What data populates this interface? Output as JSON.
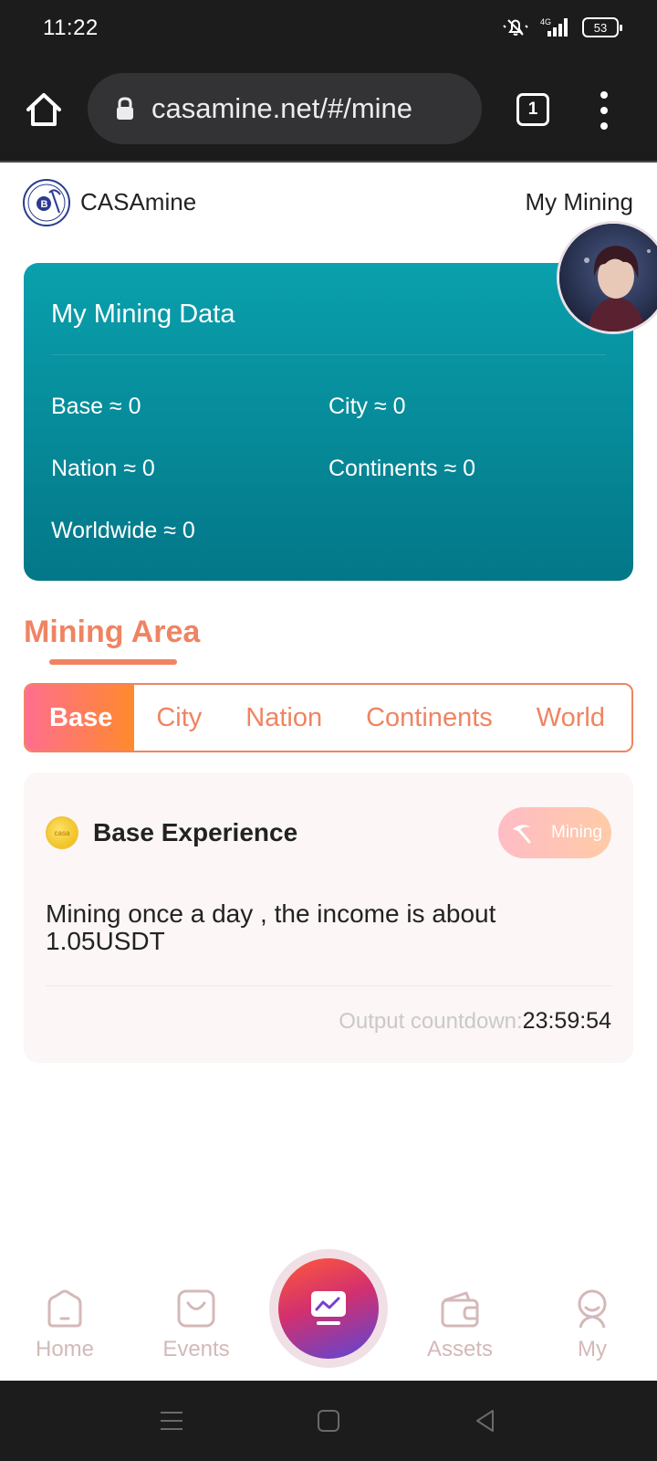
{
  "status_bar": {
    "time": "11:22",
    "network": "4G",
    "battery": "53"
  },
  "browser": {
    "url": "casamine.net/#/mine",
    "tab_count": "1"
  },
  "header": {
    "brand": "CASAmine",
    "my_mining_link": "My Mining"
  },
  "mining_data": {
    "title": "My Mining Data",
    "stats": [
      {
        "label": "Base ≈ 0"
      },
      {
        "label": "City ≈ 0"
      },
      {
        "label": "Nation ≈ 0"
      },
      {
        "label": "Continents ≈ 0"
      },
      {
        "label": "Worldwide ≈ 0"
      }
    ]
  },
  "mining_area": {
    "title": "Mining Area",
    "tabs": [
      {
        "label": "Base",
        "active": true
      },
      {
        "label": "City"
      },
      {
        "label": "Nation"
      },
      {
        "label": "Continents"
      },
      {
        "label": "World"
      }
    ]
  },
  "experience_card": {
    "coin_text": "casa",
    "title": "Base Experience",
    "mining_button": "Mining",
    "description": "Mining once a day , the income is about 1.05USDT",
    "countdown_label": "Output countdown:",
    "countdown_value": "23:59:54"
  },
  "bottom_nav": {
    "items": [
      {
        "label": "Home",
        "icon": "home-icon"
      },
      {
        "label": "Events",
        "icon": "shopping-bag-icon"
      },
      {
        "label": "",
        "icon": "chart-screen-icon"
      },
      {
        "label": "Assets",
        "icon": "wallet-icon"
      },
      {
        "label": "My",
        "icon": "profile-icon"
      }
    ]
  },
  "colors": {
    "accent": "#ef8462",
    "card_teal_top": "#0aa0ad",
    "card_teal_bottom": "#037788",
    "nav_inactive": "#d4b9b8"
  }
}
